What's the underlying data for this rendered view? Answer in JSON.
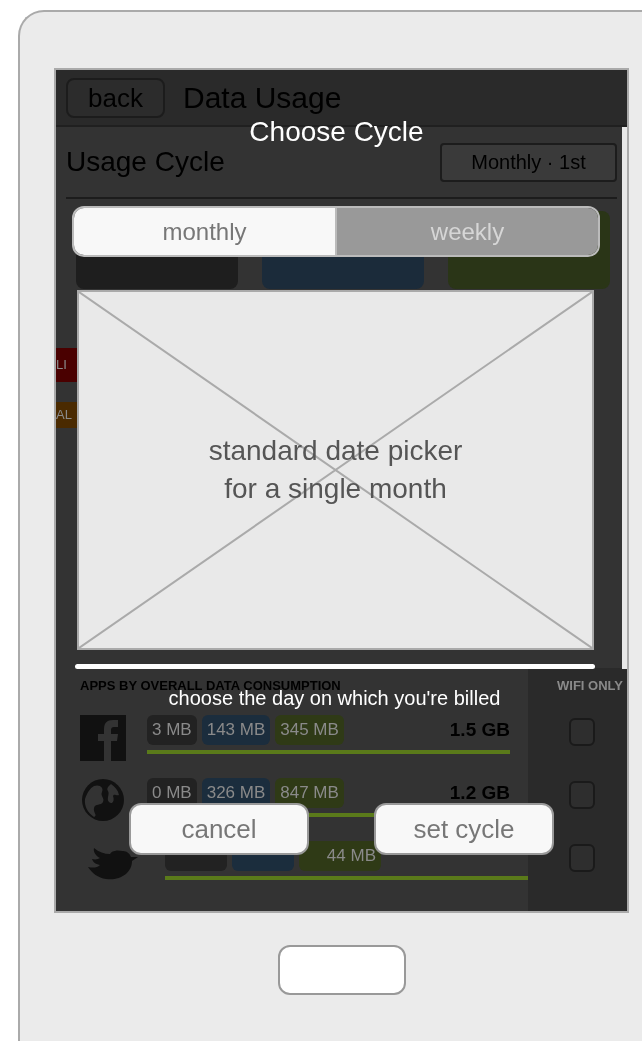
{
  "screen": {
    "back_button": "back",
    "title": "Data Usage",
    "usage_cycle": {
      "label": "Usage Cycle",
      "value": "Monthly · 1st"
    },
    "stat_tiles": [
      {
        "color": "#1e1e1e"
      },
      {
        "color": "#1b2b3a"
      },
      {
        "color": "#2a3517"
      }
    ],
    "badges": [
      {
        "label": "LI",
        "color": "#4a0000"
      },
      {
        "label": "AL",
        "color": "#4a2a00"
      }
    ],
    "apps": {
      "heading": "APPS BY OVERALL DATA CONSUMPTION",
      "wifi_heading": "WIFI ONLY",
      "rows": [
        {
          "pills": [
            {
              "text": "3 MB",
              "color": "#222222"
            },
            {
              "text": "143 MB",
              "color": "#1b2d3d"
            },
            {
              "text": "345 MB",
              "color": "#2f3a16"
            }
          ],
          "total": "1.5 GB",
          "wifi_only": false
        },
        {
          "pills": [
            {
              "text": "0 MB",
              "color": "#222222"
            },
            {
              "text": "326 MB",
              "color": "#1b2d3d"
            },
            {
              "text": "847 MB",
              "color": "#2f3a16"
            }
          ],
          "total": "1.2 GB",
          "wifi_only": false
        },
        {
          "pills": [
            {
              "color": "#222222"
            },
            {
              "color": "#1b2d3d"
            },
            {
              "text": "44 MB",
              "color": "#2f3a16"
            }
          ],
          "wifi_only": false
        }
      ]
    }
  },
  "dialog": {
    "title": "Choose Cycle",
    "segments": [
      {
        "label": "monthly",
        "selected": true
      },
      {
        "label": "weekly",
        "selected": false
      }
    ],
    "placeholder": "standard date picker\nfor a single month",
    "hint": "choose the day on which you're billed",
    "buttons": [
      {
        "label": "cancel"
      },
      {
        "label": "set cycle"
      }
    ]
  }
}
